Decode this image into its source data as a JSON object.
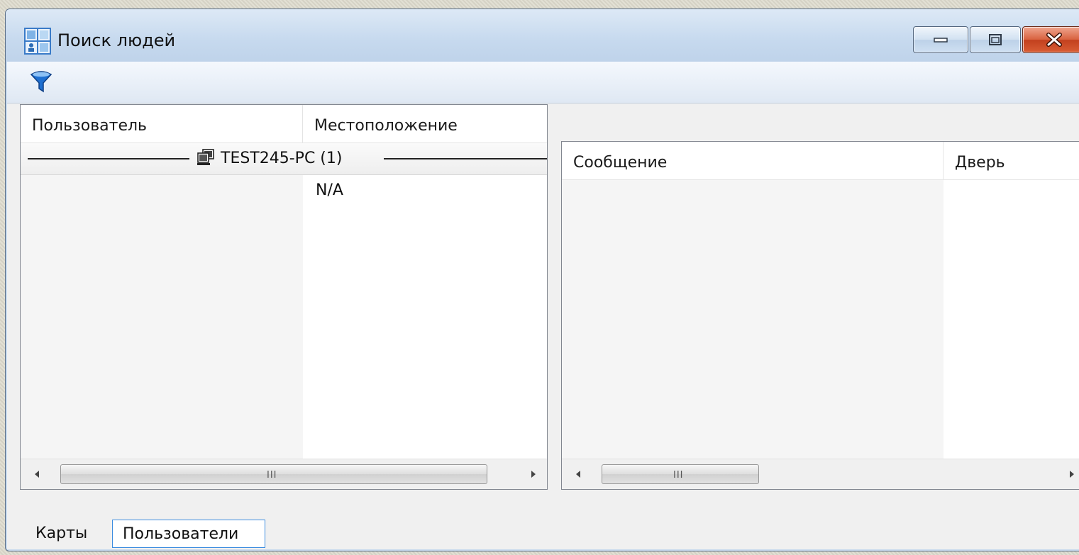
{
  "window": {
    "title": "Поиск людей",
    "icons": {
      "app": "people-search-icon",
      "minimize": "minimize-icon",
      "maximize": "maximize-icon",
      "close": "close-icon"
    }
  },
  "toolbar": {
    "filter_icon": "filter-icon"
  },
  "users_panel": {
    "columns": [
      "Пользователь",
      "Местоположение"
    ],
    "group": {
      "label": "TEST245-PC (1)",
      "icon": "computer-icon"
    },
    "rows": [
      {
        "user": "",
        "location": "N/A"
      }
    ],
    "scrollbar_grip": "III"
  },
  "events_panel": {
    "columns": [
      "Сообщение",
      "Дверь"
    ],
    "rows": [],
    "scrollbar_grip": "III"
  },
  "tabs": [
    {
      "label": "Карты",
      "selected": false
    },
    {
      "label": "Пользователи",
      "selected": true
    }
  ],
  "colors": {
    "titlebar": "#c6d9ee",
    "close_button": "#d8613e",
    "selected_tab_border": "#3c8de0",
    "filter_icon": "#1e6fd0"
  }
}
